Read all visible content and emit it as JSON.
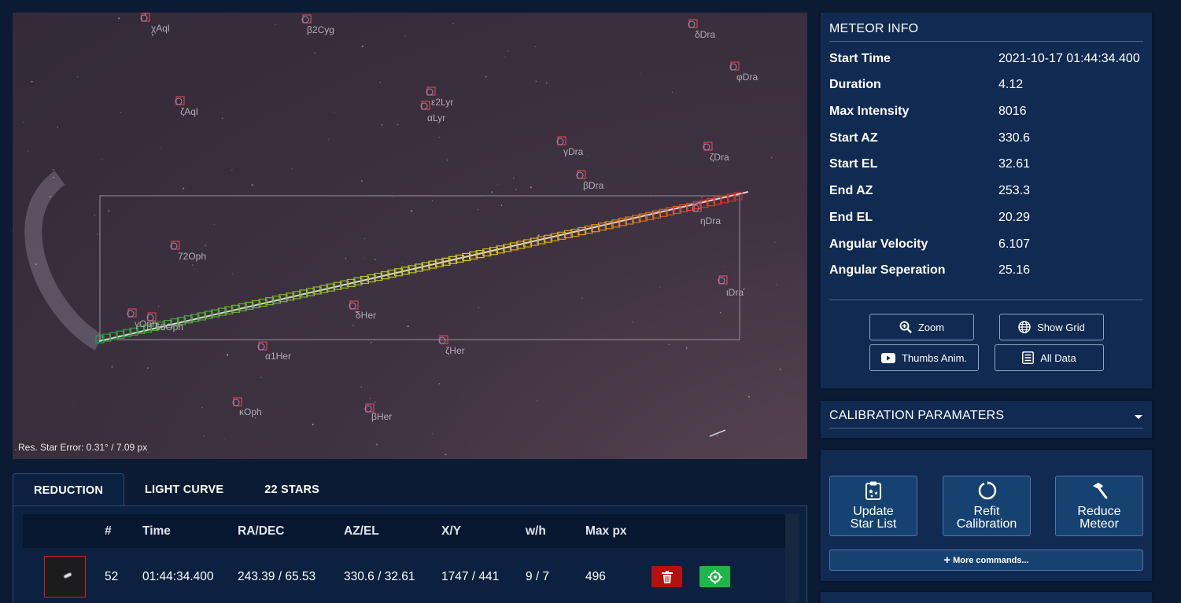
{
  "sky": {
    "res_error": "Res. Star Error: 0.31° / 7.09 px",
    "stars": [
      "χAql",
      "β2Cyg",
      "δDra",
      "φDra",
      "ζAql",
      "ε2Lyr",
      "αLyr",
      "γDra",
      "ζDra",
      "βDra",
      "ηDra",
      "72Oph",
      "ιDra",
      "γOph",
      "60Oph",
      "δHer",
      "α1Her",
      "ζHer",
      "κOph",
      "βHer"
    ]
  },
  "tabs": [
    "REDUCTION",
    "LIGHT CURVE",
    "22 STARS"
  ],
  "table": {
    "headers": [
      "#",
      "Time",
      "RA/DEC",
      "AZ/EL",
      "X/Y",
      "w/h",
      "Max px"
    ],
    "row": {
      "num": "52",
      "time": "01:44:34.400",
      "radec": "243.39 / 65.53",
      "azel": "330.6 / 32.61",
      "xy": "1747 / 441",
      "wh": "9 / 7",
      "maxpx": "496"
    }
  },
  "meteor_info": {
    "title": "METEOR INFO",
    "rows": [
      {
        "label": "Start Time",
        "value": "2021-10-17 01:44:34.400"
      },
      {
        "label": "Duration",
        "value": "4.12"
      },
      {
        "label": "Max Intensity",
        "value": "8016"
      },
      {
        "label": "Start AZ",
        "value": "330.6"
      },
      {
        "label": "Start EL",
        "value": "32.61"
      },
      {
        "label": "End AZ",
        "value": "253.3"
      },
      {
        "label": "End EL",
        "value": "20.29"
      },
      {
        "label": "Angular Velocity",
        "value": "6.107"
      },
      {
        "label": "Angular Seperation",
        "value": "25.16"
      }
    ],
    "buttons": {
      "zoom": "Zoom",
      "show_grid": "Show Grid",
      "thumbs_anim": "Thumbs Anim.",
      "all_data": "All Data"
    }
  },
  "calibration": {
    "title": "CALIBRATION PARAMATERS"
  },
  "commands": {
    "update_line1": "Update",
    "update_line2": "Star List",
    "refit_line1": "Refit",
    "refit_line2": "Calibration",
    "reduce_line1": "Reduce",
    "reduce_line2": "Meteor",
    "more": "More commands..."
  },
  "colors": {
    "bg": "#0b1b33",
    "panel": "#102a52",
    "delete": "#b31010",
    "select": "#1eb64a"
  }
}
